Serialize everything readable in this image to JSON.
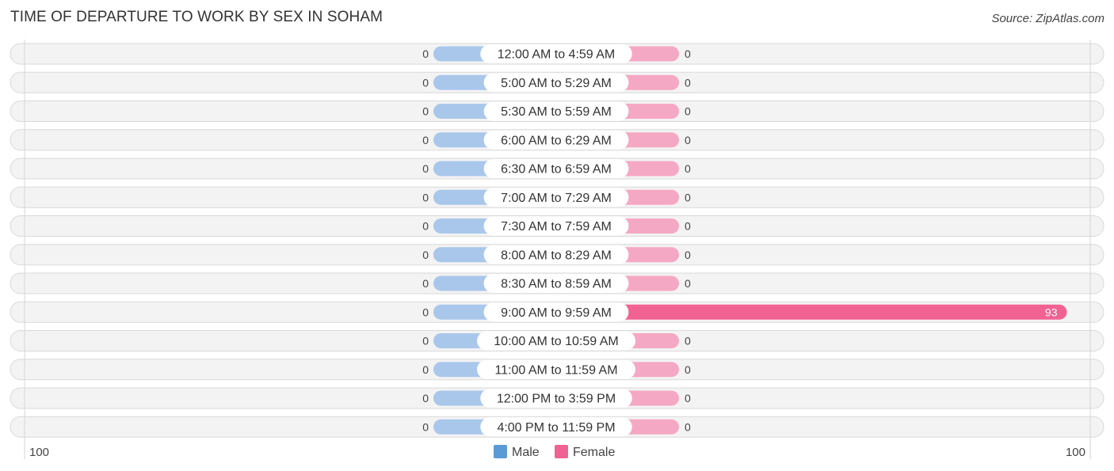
{
  "header": {
    "title": "TIME OF DEPARTURE TO WORK BY SEX IN SOHAM",
    "source": "Source: ZipAtlas.com"
  },
  "colors": {
    "male": "#a9c7eb",
    "male_legend": "#5b9bd5",
    "female_light": "#f5a8c3",
    "female": "#f06292",
    "female_legend": "#f06292"
  },
  "chart_data": {
    "type": "bar",
    "orientation": "horizontal-diverging",
    "title": "TIME OF DEPARTURE TO WORK BY SEX IN SOHAM",
    "categories": [
      "12:00 AM to 4:59 AM",
      "5:00 AM to 5:29 AM",
      "5:30 AM to 5:59 AM",
      "6:00 AM to 6:29 AM",
      "6:30 AM to 6:59 AM",
      "7:00 AM to 7:29 AM",
      "7:30 AM to 7:59 AM",
      "8:00 AM to 8:29 AM",
      "8:30 AM to 8:59 AM",
      "9:00 AM to 9:59 AM",
      "10:00 AM to 10:59 AM",
      "11:00 AM to 11:59 AM",
      "12:00 PM to 3:59 PM",
      "4:00 PM to 11:59 PM"
    ],
    "series": [
      {
        "name": "Male",
        "values": [
          0,
          0,
          0,
          0,
          0,
          0,
          0,
          0,
          0,
          0,
          0,
          0,
          0,
          0
        ]
      },
      {
        "name": "Female",
        "values": [
          0,
          0,
          0,
          0,
          0,
          0,
          0,
          0,
          0,
          93,
          0,
          0,
          0,
          0
        ]
      }
    ],
    "axis": {
      "min_label": "100",
      "max_label": "100",
      "range": [
        -100,
        100
      ]
    },
    "legend": {
      "position": "bottom-center",
      "entries": [
        "Male",
        "Female"
      ]
    },
    "grid": false
  }
}
